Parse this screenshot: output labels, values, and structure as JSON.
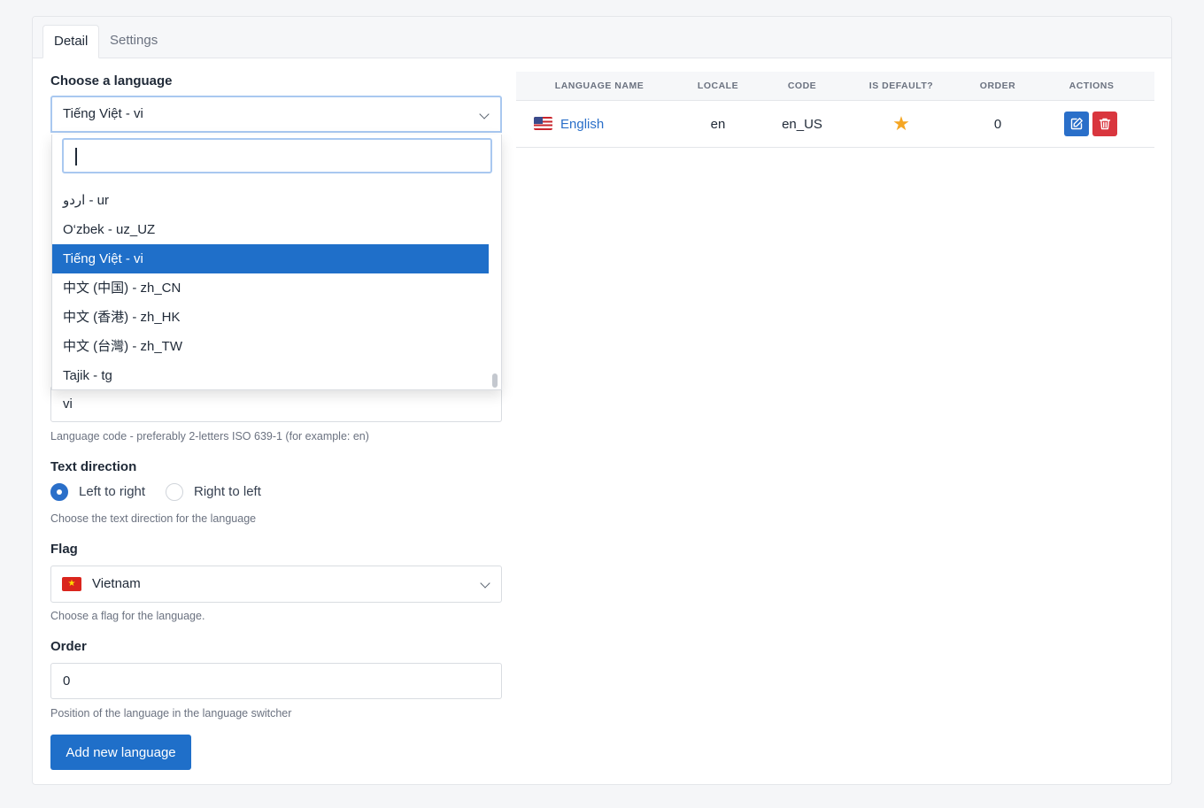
{
  "tabs": [
    {
      "label": "Detail",
      "active": true
    },
    {
      "label": "Settings",
      "active": false
    }
  ],
  "form": {
    "language": {
      "label": "Choose a language",
      "selected": "Tiếng Việt - vi",
      "search_value": "",
      "options": [
        "اردو - ur",
        "O‘zbek - uz_UZ",
        "Tiếng Việt - vi",
        "中文 (中国) - zh_CN",
        "中文 (香港) - zh_HK",
        "中文 (台灣) - zh_TW",
        "Tajik - tg"
      ],
      "highlighted_option": "Tiếng Việt - vi"
    },
    "code": {
      "value": "vi",
      "hint": "Language code - preferably 2-letters ISO 639-1 (for example: en)"
    },
    "direction": {
      "label": "Text direction",
      "options": [
        {
          "label": "Left to right",
          "checked": true
        },
        {
          "label": "Right to left",
          "checked": false
        }
      ],
      "hint": "Choose the text direction for the language"
    },
    "flag": {
      "label": "Flag",
      "selected": "Vietnam",
      "hint": "Choose a flag for the language."
    },
    "order": {
      "label": "Order",
      "value": "0",
      "hint": "Position of the language in the language switcher"
    },
    "submit_label": "Add new language"
  },
  "table": {
    "headers": [
      "Language name",
      "Locale",
      "Code",
      "Is default?",
      "Order",
      "Actions"
    ],
    "rows": [
      {
        "name": "English",
        "locale": "en",
        "code": "en_US",
        "is_default": true,
        "order": "0",
        "flag_icon": "us-flag-icon"
      }
    ]
  },
  "colors": {
    "primary": "#1f6fc9",
    "danger": "#d9363e",
    "star": "#f5a623",
    "focus_ring": "#a9c8f0"
  }
}
